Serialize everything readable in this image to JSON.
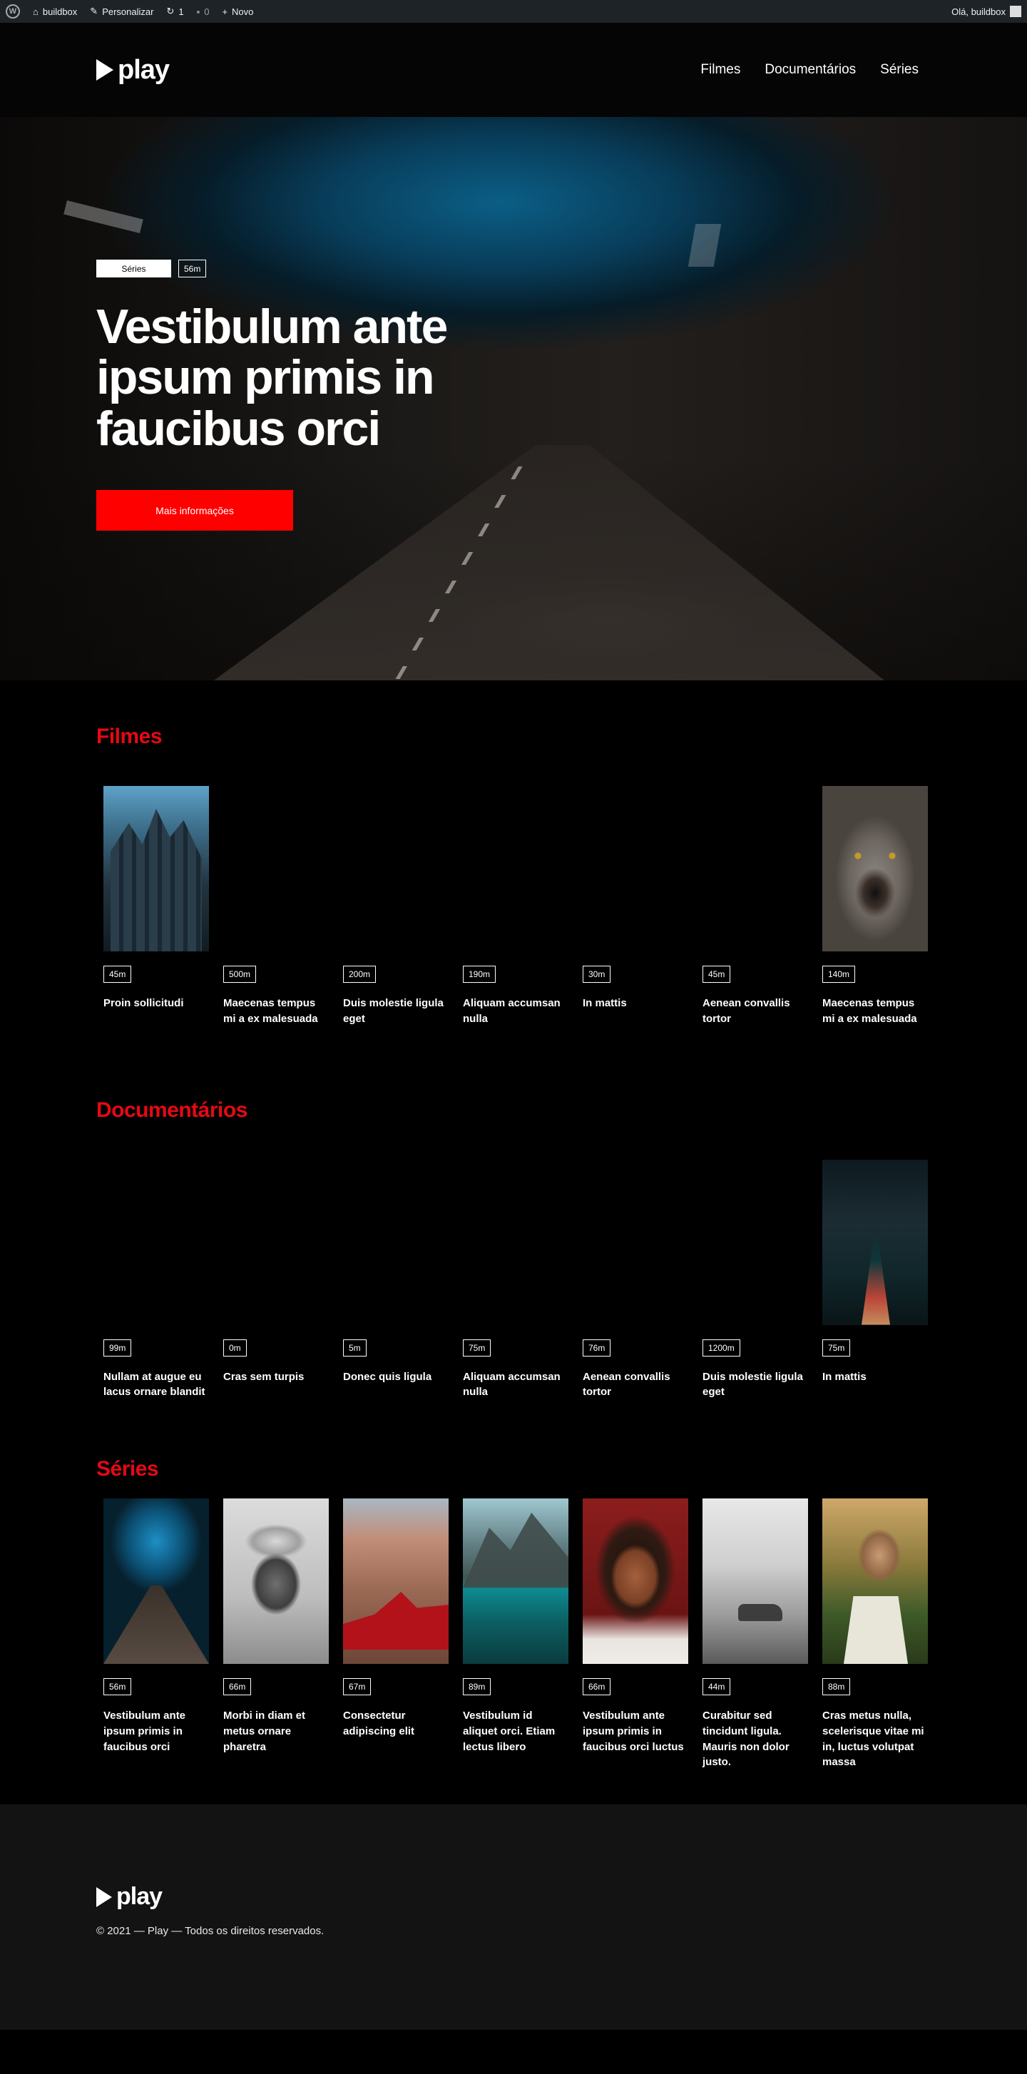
{
  "adminbar": {
    "site_name": "buildbox",
    "customize": "Personalizar",
    "updates_count": "1",
    "comments_count": "0",
    "new": "Novo",
    "greeting": "Olá, buildbox"
  },
  "header": {
    "logo_text": "play",
    "nav": [
      "Filmes",
      "Documentários",
      "Séries"
    ]
  },
  "hero": {
    "category_tag": "Séries",
    "duration_tag": "56m",
    "title": "Vestibulum ante ipsum primis in faucibus orci",
    "button_label": "Mais informações"
  },
  "sections": {
    "filmes": {
      "title": "Filmes",
      "items": [
        {
          "duration": "45m",
          "title": "Proin sollicitudi"
        },
        {
          "duration": "500m",
          "title": "Maecenas tempus mi a ex malesuada"
        },
        {
          "duration": "200m",
          "title": "Duis molestie ligula eget"
        },
        {
          "duration": "190m",
          "title": "Aliquam accumsan nulla"
        },
        {
          "duration": "30m",
          "title": "In mattis"
        },
        {
          "duration": "45m",
          "title": "Aenean convallis tortor"
        },
        {
          "duration": "140m",
          "title": "Maecenas tempus mi a ex malesuada"
        }
      ]
    },
    "documentarios": {
      "title": "Documentários",
      "items": [
        {
          "duration": "99m",
          "title": "Nullam at augue eu lacus ornare blandit"
        },
        {
          "duration": "0m",
          "title": "Cras sem turpis"
        },
        {
          "duration": "5m",
          "title": "Donec quis ligula"
        },
        {
          "duration": "75m",
          "title": "Aliquam accumsan nulla"
        },
        {
          "duration": "76m",
          "title": "Aenean convallis tortor"
        },
        {
          "duration": "1200m",
          "title": "Duis molestie ligula eget"
        },
        {
          "duration": "75m",
          "title": "In mattis"
        }
      ]
    },
    "series": {
      "title": "Séries",
      "items": [
        {
          "duration": "56m",
          "title": "Vestibulum ante ipsum primis in faucibus orci"
        },
        {
          "duration": "66m",
          "title": "Morbi in diam et metus ornare pharetra"
        },
        {
          "duration": "67m",
          "title": "Consectetur adipiscing elit"
        },
        {
          "duration": "89m",
          "title": "Vestibulum id aliquet orci. Etiam lectus libero"
        },
        {
          "duration": "66m",
          "title": "Vestibulum ante ipsum primis in faucibus orci luctus"
        },
        {
          "duration": "44m",
          "title": "Curabitur sed tincidunt ligula. Mauris non dolor justo."
        },
        {
          "duration": "88m",
          "title": "Cras metus nulla, scelerisque vitae mi in, luctus volutpat massa"
        }
      ]
    }
  },
  "footer": {
    "logo_text": "play",
    "copyright": "© 2021 — Play — Todos os direitos reservados."
  },
  "colors": {
    "accent": "#ff0000",
    "section_title": "#e50914",
    "background": "#000000",
    "footer_background": "#131313"
  }
}
